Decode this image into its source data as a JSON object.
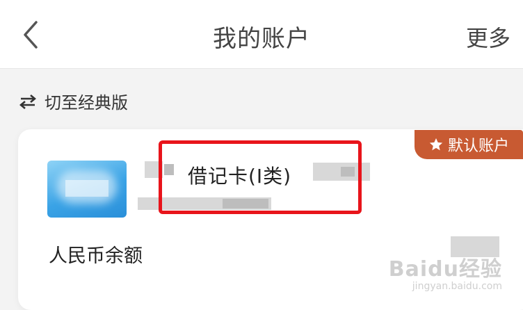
{
  "header": {
    "title": "我的账户",
    "more_label": "更多"
  },
  "switch": {
    "label": "切至经典版"
  },
  "account_card": {
    "badge_label": "默认账户",
    "card_type": "借记卡(Ⅰ类)",
    "balance_label": "人民币余额"
  },
  "watermark": {
    "main": "Baidu经验",
    "sub": "jingyan.baidu.com"
  },
  "colors": {
    "badge": "#c85a32",
    "highlight": "#e8141b",
    "card_thumb": "#3aa3e6"
  },
  "icons": {
    "back": "chevron-left-icon",
    "switch": "swap-arrows-icon",
    "badge": "star-icon"
  }
}
